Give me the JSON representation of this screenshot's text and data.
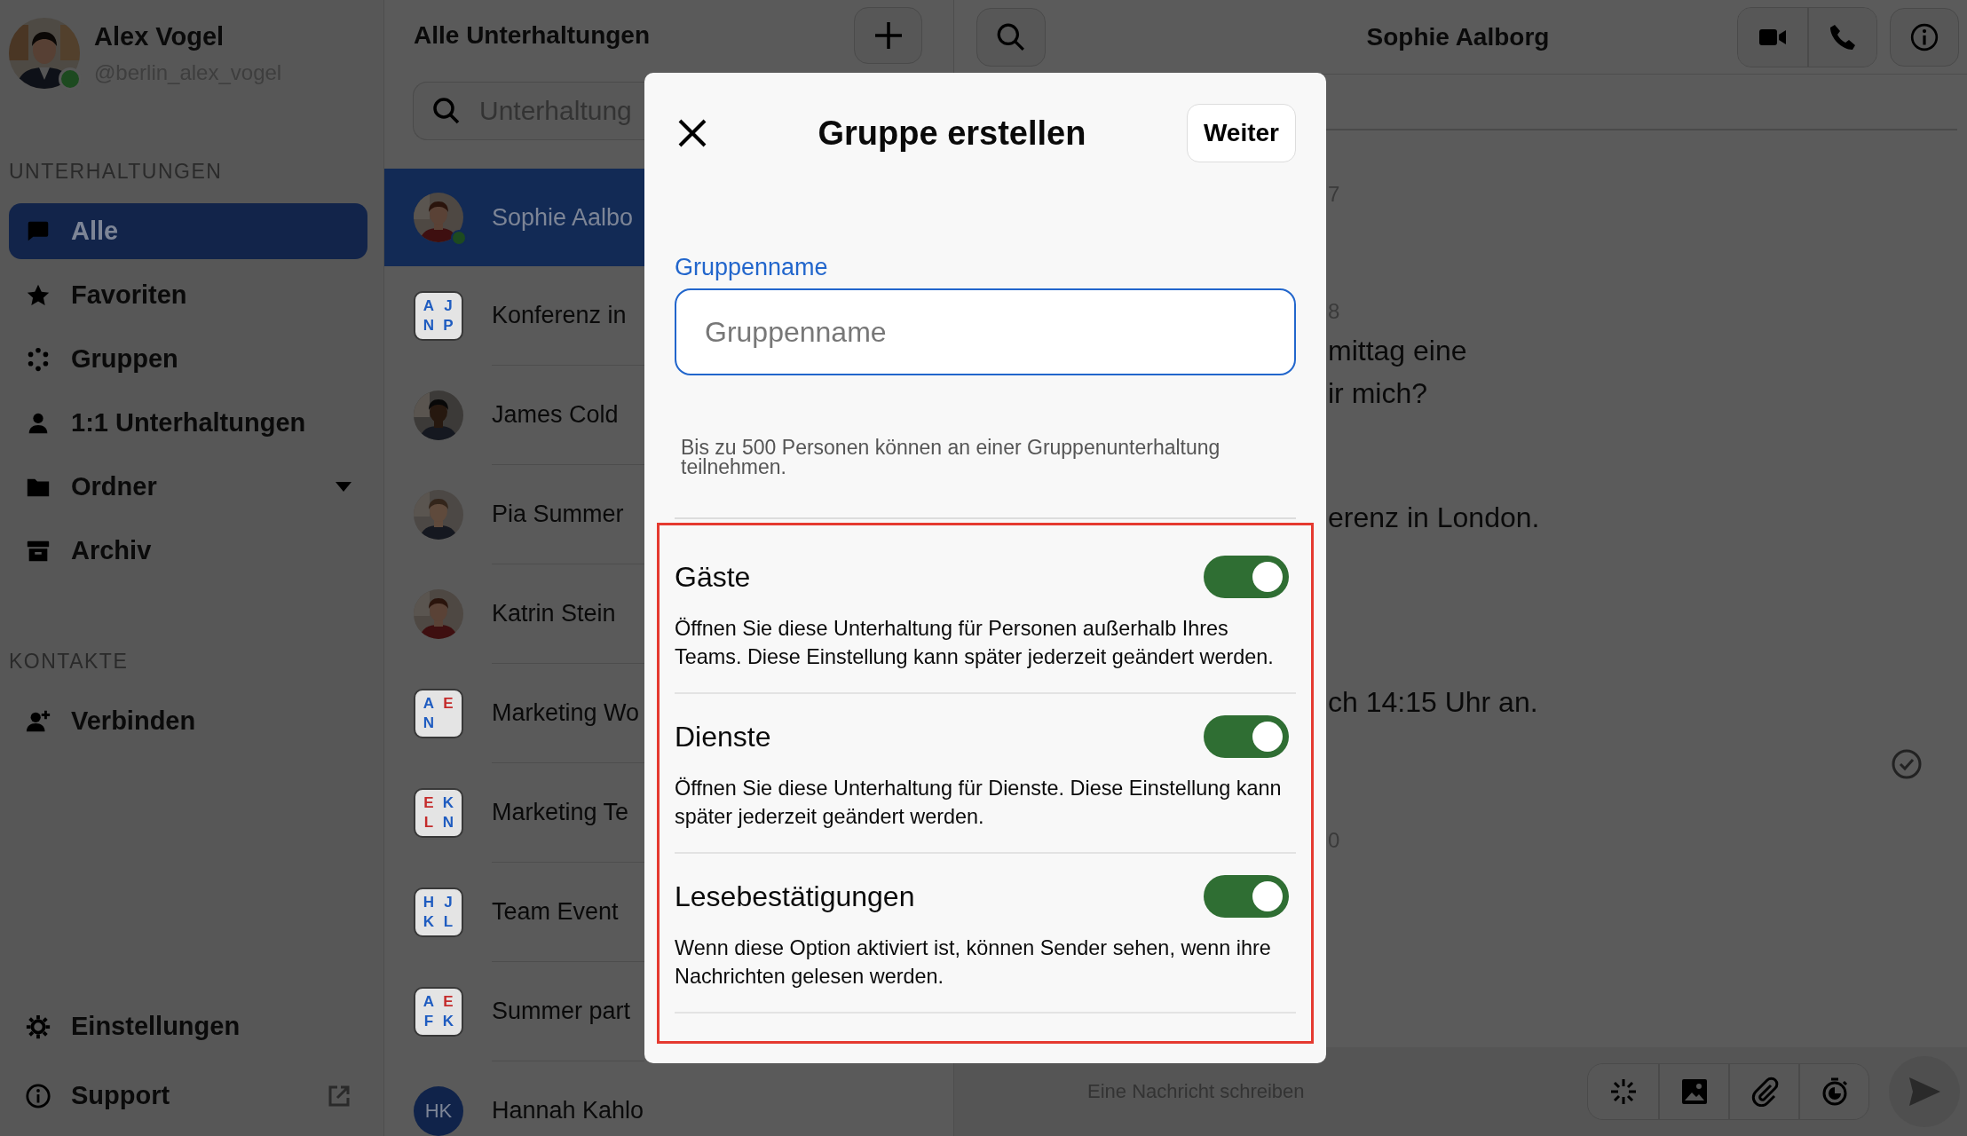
{
  "user": {
    "name": "Alex Vogel",
    "handle": "@berlin_alex_vogel",
    "online": true
  },
  "sidebar": {
    "sections": [
      {
        "heading": "UNTERHALTUNGEN",
        "items": [
          {
            "label": "Alle",
            "selected": true,
            "kind": "plain"
          },
          {
            "label": "Favoriten",
            "selected": false,
            "kind": "plain"
          },
          {
            "label": "Gruppen",
            "selected": false,
            "kind": "plain"
          },
          {
            "label": "1:1 Unterhaltungen",
            "selected": false,
            "kind": "plain"
          },
          {
            "label": "Ordner",
            "selected": false,
            "kind": "dropdown"
          },
          {
            "label": "Archiv",
            "selected": false,
            "kind": "plain"
          }
        ]
      },
      {
        "heading": "KONTAKTE",
        "items": [
          {
            "label": "Verbinden",
            "selected": false,
            "kind": "plain"
          }
        ]
      }
    ],
    "footer": [
      {
        "label": "Einstellungen",
        "selected": false,
        "kind": "plain"
      },
      {
        "label": "Support",
        "selected": false,
        "kind": "external"
      }
    ]
  },
  "conversations": {
    "title": "Alle Unterhaltungen",
    "search": {
      "placeholder": "Unterhaltung"
    },
    "items": [
      {
        "name": "Sophie Aalbo",
        "kind": "person",
        "selected": true,
        "online": true
      },
      {
        "name": "Konferenz in",
        "kind": "group",
        "selected": false,
        "online": false,
        "letters": [
          {
            "text": "A",
            "color": "#1f5cc0"
          },
          {
            "text": "J",
            "color": "#1f5cc0"
          },
          {
            "text": "N",
            "color": "#1f5cc0"
          },
          {
            "text": "P",
            "color": "#1f5cc0"
          }
        ]
      },
      {
        "name": "James Cold",
        "kind": "person",
        "selected": false,
        "online": false
      },
      {
        "name": "Pia Summer",
        "kind": "person",
        "selected": false,
        "online": false
      },
      {
        "name": "Katrin Stein",
        "kind": "person",
        "selected": false,
        "online": false
      },
      {
        "name": "Marketing Wo",
        "kind": "group",
        "selected": false,
        "online": false,
        "letters": [
          {
            "text": "A",
            "color": "#1f5cc0"
          },
          {
            "text": "E",
            "color": "#c42b2b"
          },
          {
            "text": "N",
            "color": "#1f5cc0"
          }
        ]
      },
      {
        "name": "Marketing Te",
        "kind": "group",
        "selected": false,
        "online": false,
        "letters": [
          {
            "text": "E",
            "color": "#c42b2b"
          },
          {
            "text": "K",
            "color": "#1f5cc0"
          },
          {
            "text": "L",
            "color": "#c42b2b"
          },
          {
            "text": "N",
            "color": "#1f5cc0"
          }
        ]
      },
      {
        "name": "Team Event",
        "kind": "group",
        "selected": false,
        "online": false,
        "letters": [
          {
            "text": "H",
            "color": "#1f5cc0"
          },
          {
            "text": "J",
            "color": "#1f5cc0"
          },
          {
            "text": "K",
            "color": "#1f5cc0"
          },
          {
            "text": "L",
            "color": "#1f5cc0"
          }
        ]
      },
      {
        "name": "Summer part",
        "kind": "group",
        "selected": false,
        "online": false,
        "letters": [
          {
            "text": "A",
            "color": "#1f5cc0"
          },
          {
            "text": "E",
            "color": "#c42b2b"
          },
          {
            "text": "F",
            "color": "#1f5cc0"
          },
          {
            "text": "K",
            "color": "#1f5cc0"
          }
        ]
      },
      {
        "name": "Hannah Kahlo",
        "kind": "initials",
        "initials": "HK",
        "selected": false,
        "online": false
      }
    ]
  },
  "chat": {
    "title": "Sophie Aalborg",
    "groups": [
      {
        "time": "7"
      },
      {
        "time": "8",
        "lines": [
          "mittag eine",
          "ir mich?"
        ],
        "read": false
      },
      {
        "lines": [
          "erenz in London."
        ],
        "read": false
      },
      {
        "lines": [
          "ch 14:15 Uhr an."
        ],
        "read": true
      },
      {
        "time": "0"
      }
    ],
    "composer": {
      "placeholder": "Eine Nachricht schreiben"
    }
  },
  "dialog": {
    "title": "Gruppe erstellen",
    "next_button": "Weiter",
    "name_field": {
      "label": "Gruppenname",
      "placeholder": "Gruppenname"
    },
    "hint": "Bis zu 500 Personen können an einer Gruppenunterhaltung teilnehmen.",
    "options": [
      {
        "title": "Gäste",
        "description": "Öffnen Sie diese Unterhaltung für Personen außerhalb Ihres Teams. Diese Einstellung kann später jederzeit geändert werden.",
        "on": true
      },
      {
        "title": "Dienste",
        "description": "Öffnen Sie diese Unterhaltung für Dienste. Diese Einstellung kann später jederzeit geändert werden.",
        "on": true
      },
      {
        "title": "Lesebestätigungen",
        "description": "Wenn diese Option aktiviert ist, können Sender sehen, wenn ihre Nachrichten gelesen werden.",
        "on": true
      }
    ]
  }
}
